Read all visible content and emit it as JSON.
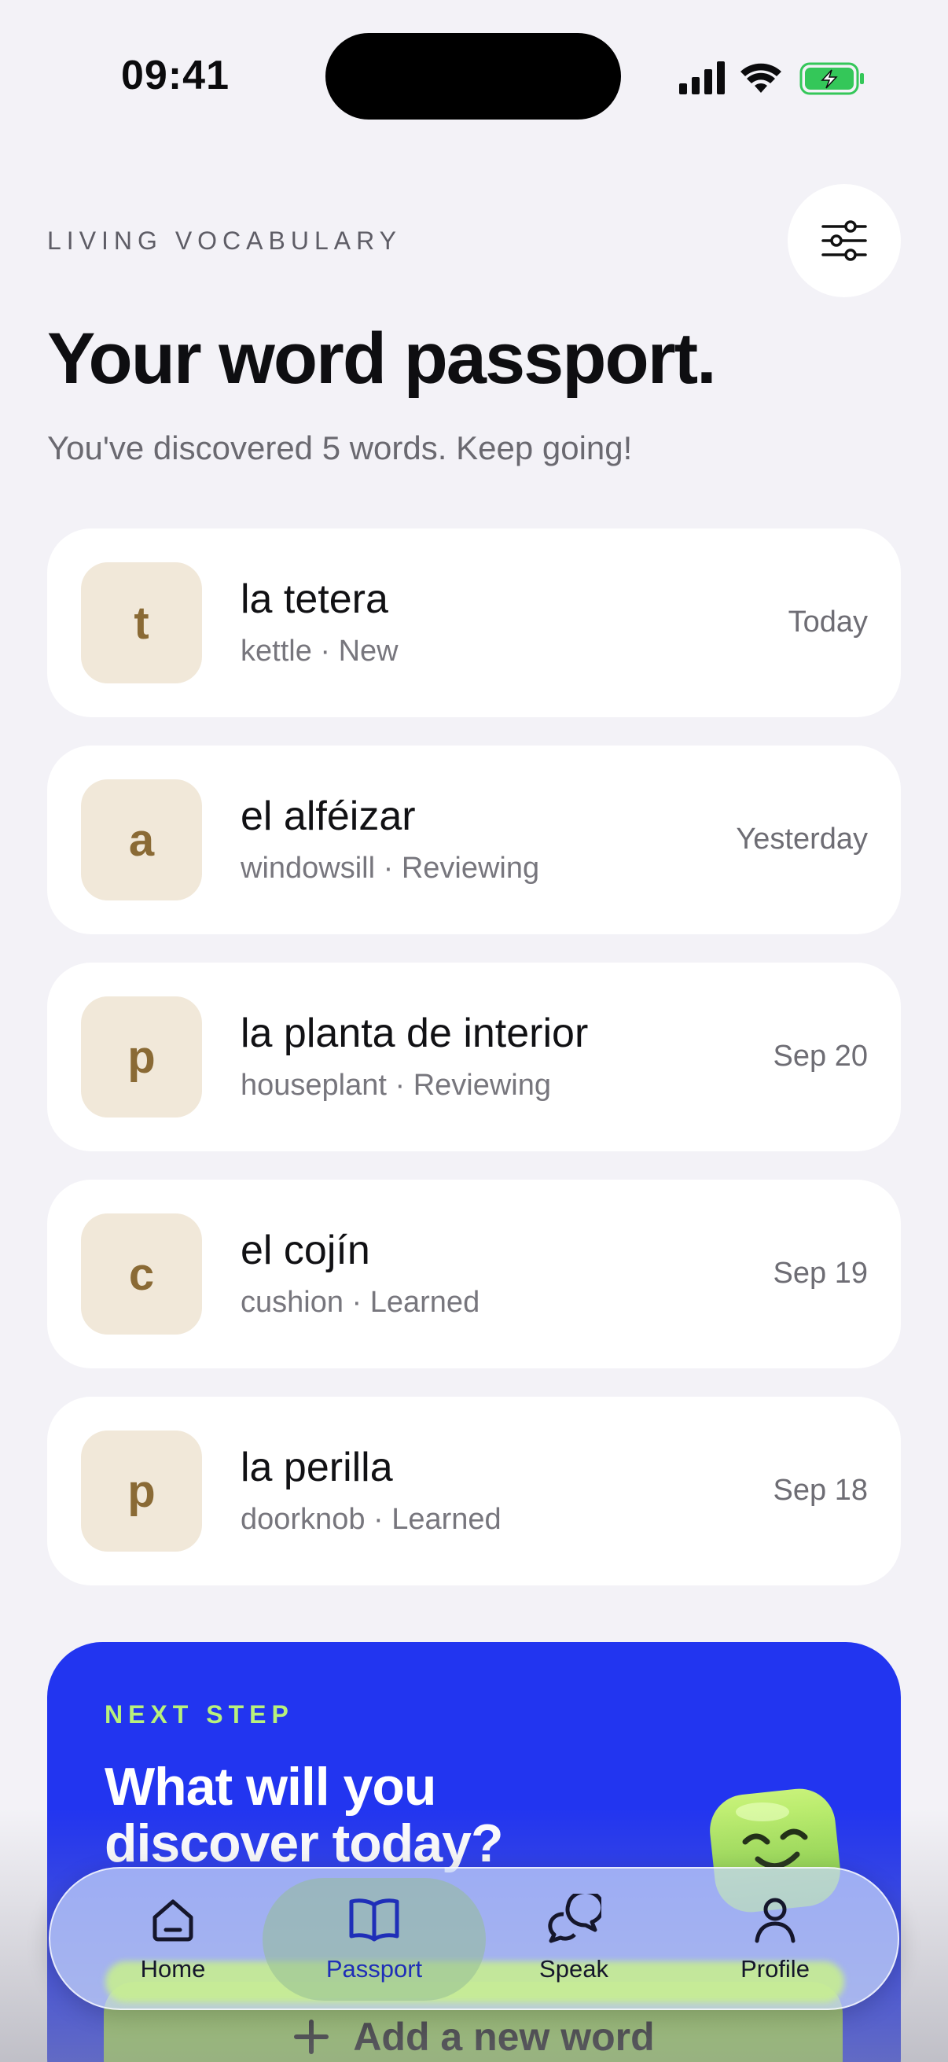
{
  "status": {
    "time": "09:41"
  },
  "header": {
    "eyebrow": "LIVING VOCABULARY",
    "title": "Your word passport.",
    "subtitle": "You've discovered 5 words. Keep going!"
  },
  "words": [
    {
      "letter": "t",
      "term": "la tetera",
      "meta": "kettle · New",
      "date": "Today"
    },
    {
      "letter": "a",
      "term": "el alféizar",
      "meta": "windowsill · Reviewing",
      "date": "Yesterday"
    },
    {
      "letter": "p",
      "term": "la planta de interior",
      "meta": "houseplant · Reviewing",
      "date": "Sep 20"
    },
    {
      "letter": "c",
      "term": "el cojín",
      "meta": "cushion · Learned",
      "date": "Sep 19"
    },
    {
      "letter": "p",
      "term": "la perilla",
      "meta": "doorknob · Learned",
      "date": "Sep 18"
    }
  ],
  "promo": {
    "eyebrow": "NEXT STEP",
    "title": "What will you discover today?",
    "button_label": "Add a new word"
  },
  "tabs": [
    {
      "label": "Home",
      "icon": "home-icon"
    },
    {
      "label": "Passport",
      "icon": "book-icon",
      "active": true
    },
    {
      "label": "Speak",
      "icon": "chat-bubbles-icon"
    },
    {
      "label": "Profile",
      "icon": "person-icon"
    }
  ],
  "colors": {
    "background": "#F3F2F7",
    "accent_blue": "#2235F0",
    "accent_green": "#9BD45A",
    "tile_beige": "#F1E8D9",
    "tile_letter": "#8A6A35"
  }
}
